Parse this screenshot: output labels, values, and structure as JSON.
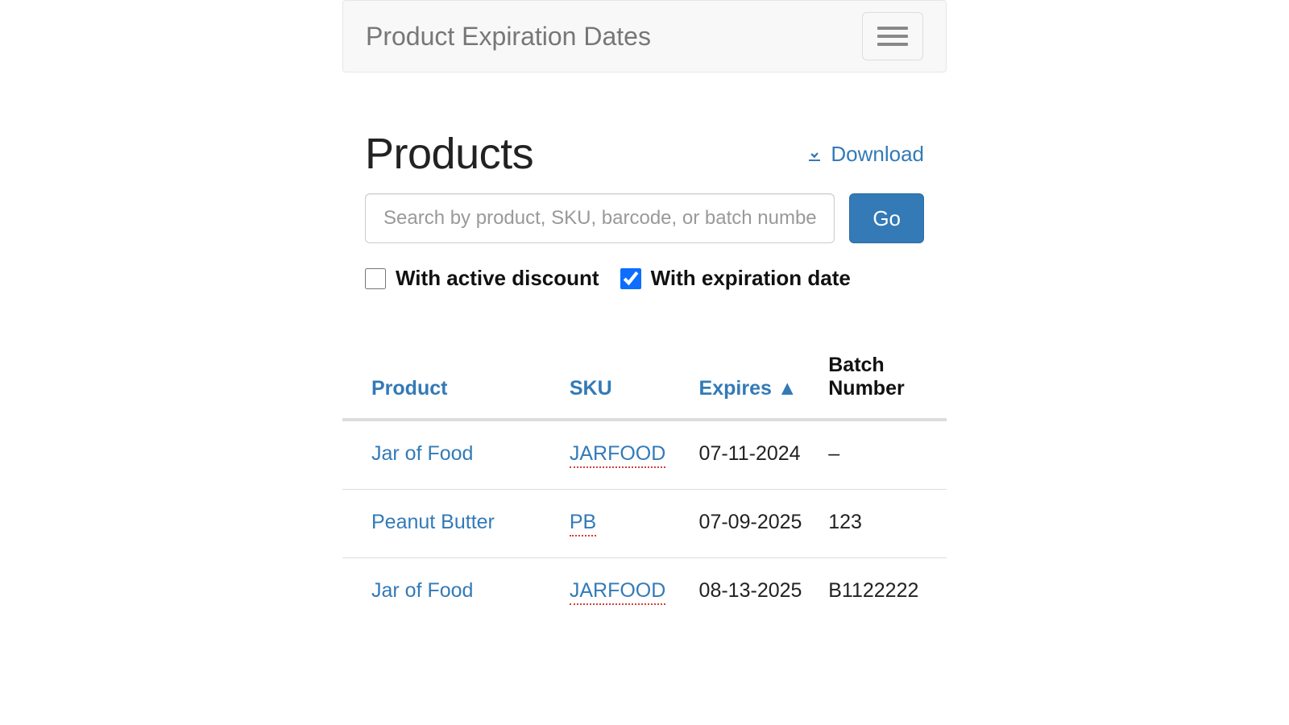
{
  "navbar": {
    "brand": "Product Expiration Dates"
  },
  "header": {
    "title": "Products",
    "download_label": "Download"
  },
  "search": {
    "placeholder": "Search by product, SKU, barcode, or batch number",
    "go_label": "Go"
  },
  "filters": {
    "active_discount_label": "With active discount",
    "active_discount_checked": false,
    "expiration_date_label": "With expiration date",
    "expiration_date_checked": true
  },
  "table": {
    "columns": {
      "product": "Product",
      "sku": "SKU",
      "expires": "Expires ▲",
      "batch": "Batch Number"
    },
    "rows": [
      {
        "product": "Jar of Food",
        "sku": "JARFOOD",
        "expires": "07-11-2024",
        "batch": "–"
      },
      {
        "product": "Peanut Butter",
        "sku": "PB",
        "expires": "07-09-2025",
        "batch": "123"
      },
      {
        "product": "Jar of Food",
        "sku": "JARFOOD",
        "expires": "08-13-2025",
        "batch": "B1122222"
      }
    ]
  }
}
